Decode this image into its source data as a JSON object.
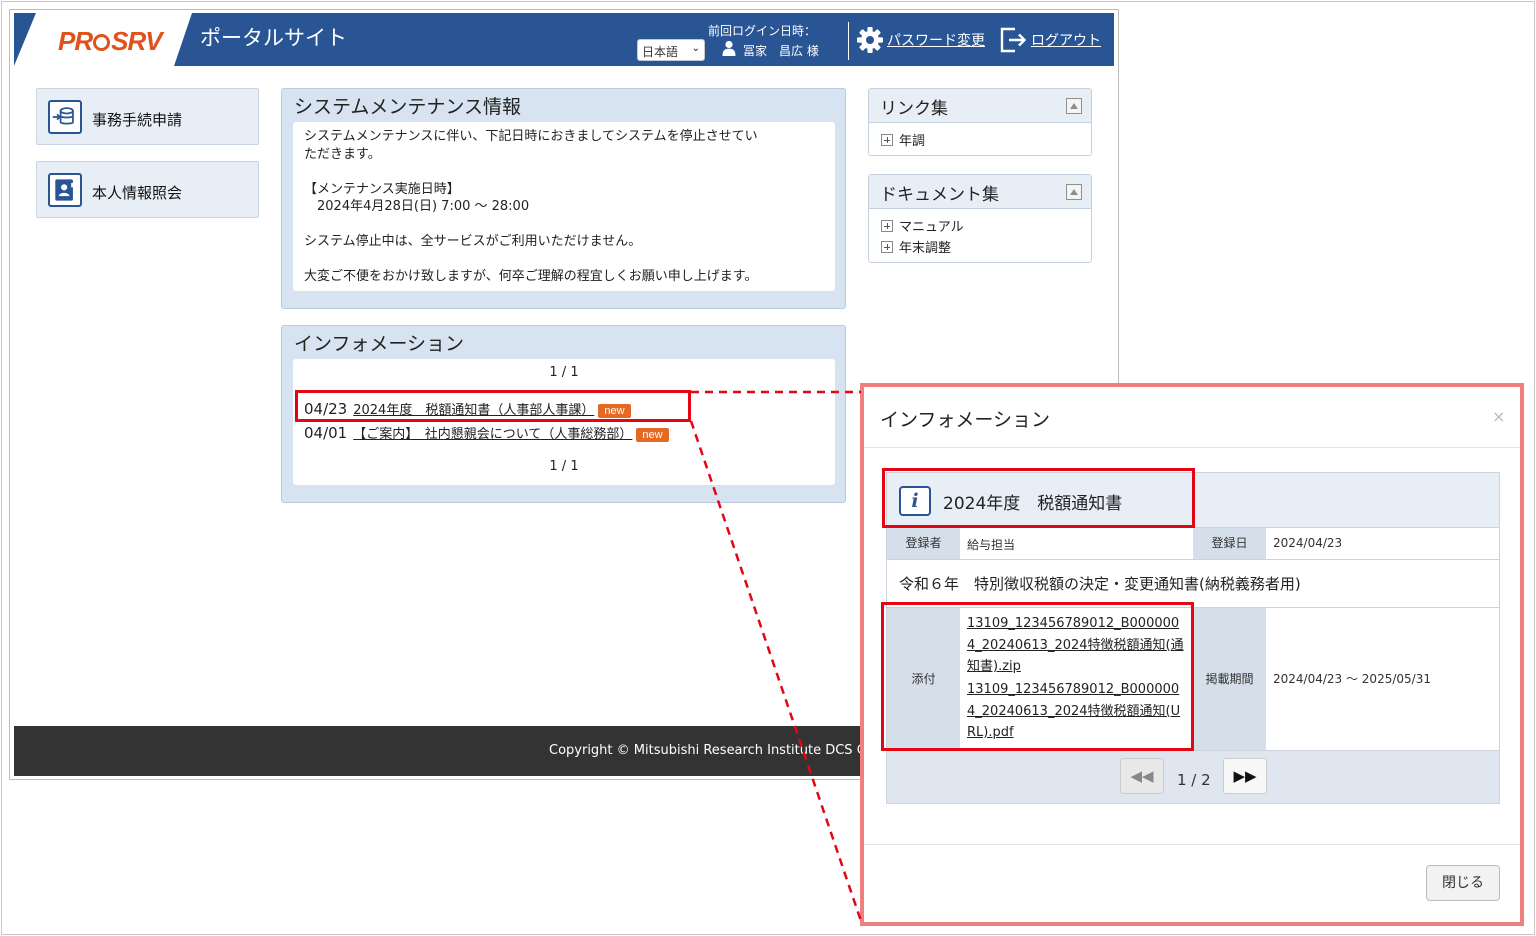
{
  "header": {
    "logo_text_left": "PR",
    "logo_text_right": "SRV",
    "site_title": "ポータルサイト",
    "last_login_label": "前回ログイン日時：",
    "language": "日本語",
    "user_name": "冨家　昌広 様",
    "password_change": "パスワード変更",
    "logout": "ログアウト"
  },
  "menu": {
    "procedure": "事務手続申請",
    "personal_info": "本人情報照会"
  },
  "maintenance": {
    "title": "システムメンテナンス情報",
    "lines": [
      "システムメンテナンスに伴い、下記日時におきましてシステムを停止させてい",
      "ただきます。",
      "",
      "【メンテナンス実施日時】",
      "　2024年4月28日(日) 7:00 ～ 28:00",
      "",
      "システム停止中は、全サービスがご利用いただけません。",
      "",
      "大変ご不便をおかけ致しますが、何卒ご理解の程宜しくお願い申し上げます。"
    ]
  },
  "information": {
    "title": "インフォメーション",
    "pager_top": "1 / 1",
    "pager_bottom": "1 / 1",
    "items": [
      {
        "date": "04/23",
        "title": "2024年度　税額通知書（人事部人事課）",
        "badge": "new"
      },
      {
        "date": "04/01",
        "title": "【ご案内】　社内懇親会について（人事総務部）",
        "badge": "new"
      }
    ]
  },
  "links": {
    "title": "リンク集",
    "items": [
      "年調"
    ]
  },
  "documents": {
    "title": "ドキュメント集",
    "items": [
      "マニュアル",
      "年末調整"
    ]
  },
  "footer": {
    "copyright": "Copyright © Mitsubishi Research Institute DCS C"
  },
  "modal": {
    "title": "インフォメーション",
    "close_x": "×",
    "item_title": "2024年度　税額通知書",
    "registrant_label": "登録者",
    "registrant": "給与担当",
    "reg_date_label": "登録日",
    "reg_date": "2024/04/23",
    "body": "令和６年　特別徴収税額の決定・変更通知書(納税義務者用)",
    "attach_label": "添付",
    "attachments": [
      "13109_123456789012_B0000004_20240613_2024特徴税額通知(通知書).zip",
      "13109_123456789012_B0000004_20240613_2024特徴税額通知(URL).pdf"
    ],
    "period_label": "掲載期間",
    "period": "2024/04/23 ～ 2025/05/31",
    "pager": "1 / 2",
    "close_button": "閉じる"
  },
  "colors": {
    "header_blue": "#2a5595",
    "logo_orange": "#e0521b",
    "highlight_red": "#e30613",
    "badge_orange": "#e46a24",
    "panel_bg": "#d7e3f0"
  }
}
